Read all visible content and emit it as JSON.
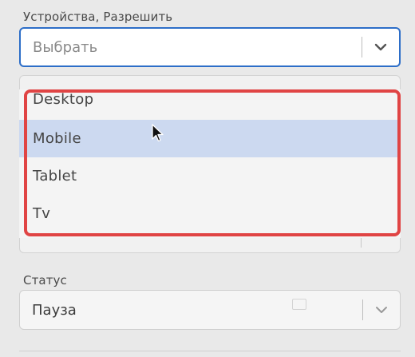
{
  "devices_field": {
    "label": "Устройства, Разрешить",
    "placeholder": "Выбрать"
  },
  "dropdown": {
    "options": [
      "Desktop",
      "Mobile",
      "Tablet",
      "Tv"
    ],
    "highlighted": "Mobile"
  },
  "status_field": {
    "label": "Статус",
    "value": "Пауза"
  },
  "colors": {
    "focus_border": "#2d6ec8",
    "option_highlight": "#ccd9f0",
    "annotation_frame": "#e04444"
  },
  "icons": [
    "chevron-down-icon",
    "mouse-cursor-icon"
  ]
}
